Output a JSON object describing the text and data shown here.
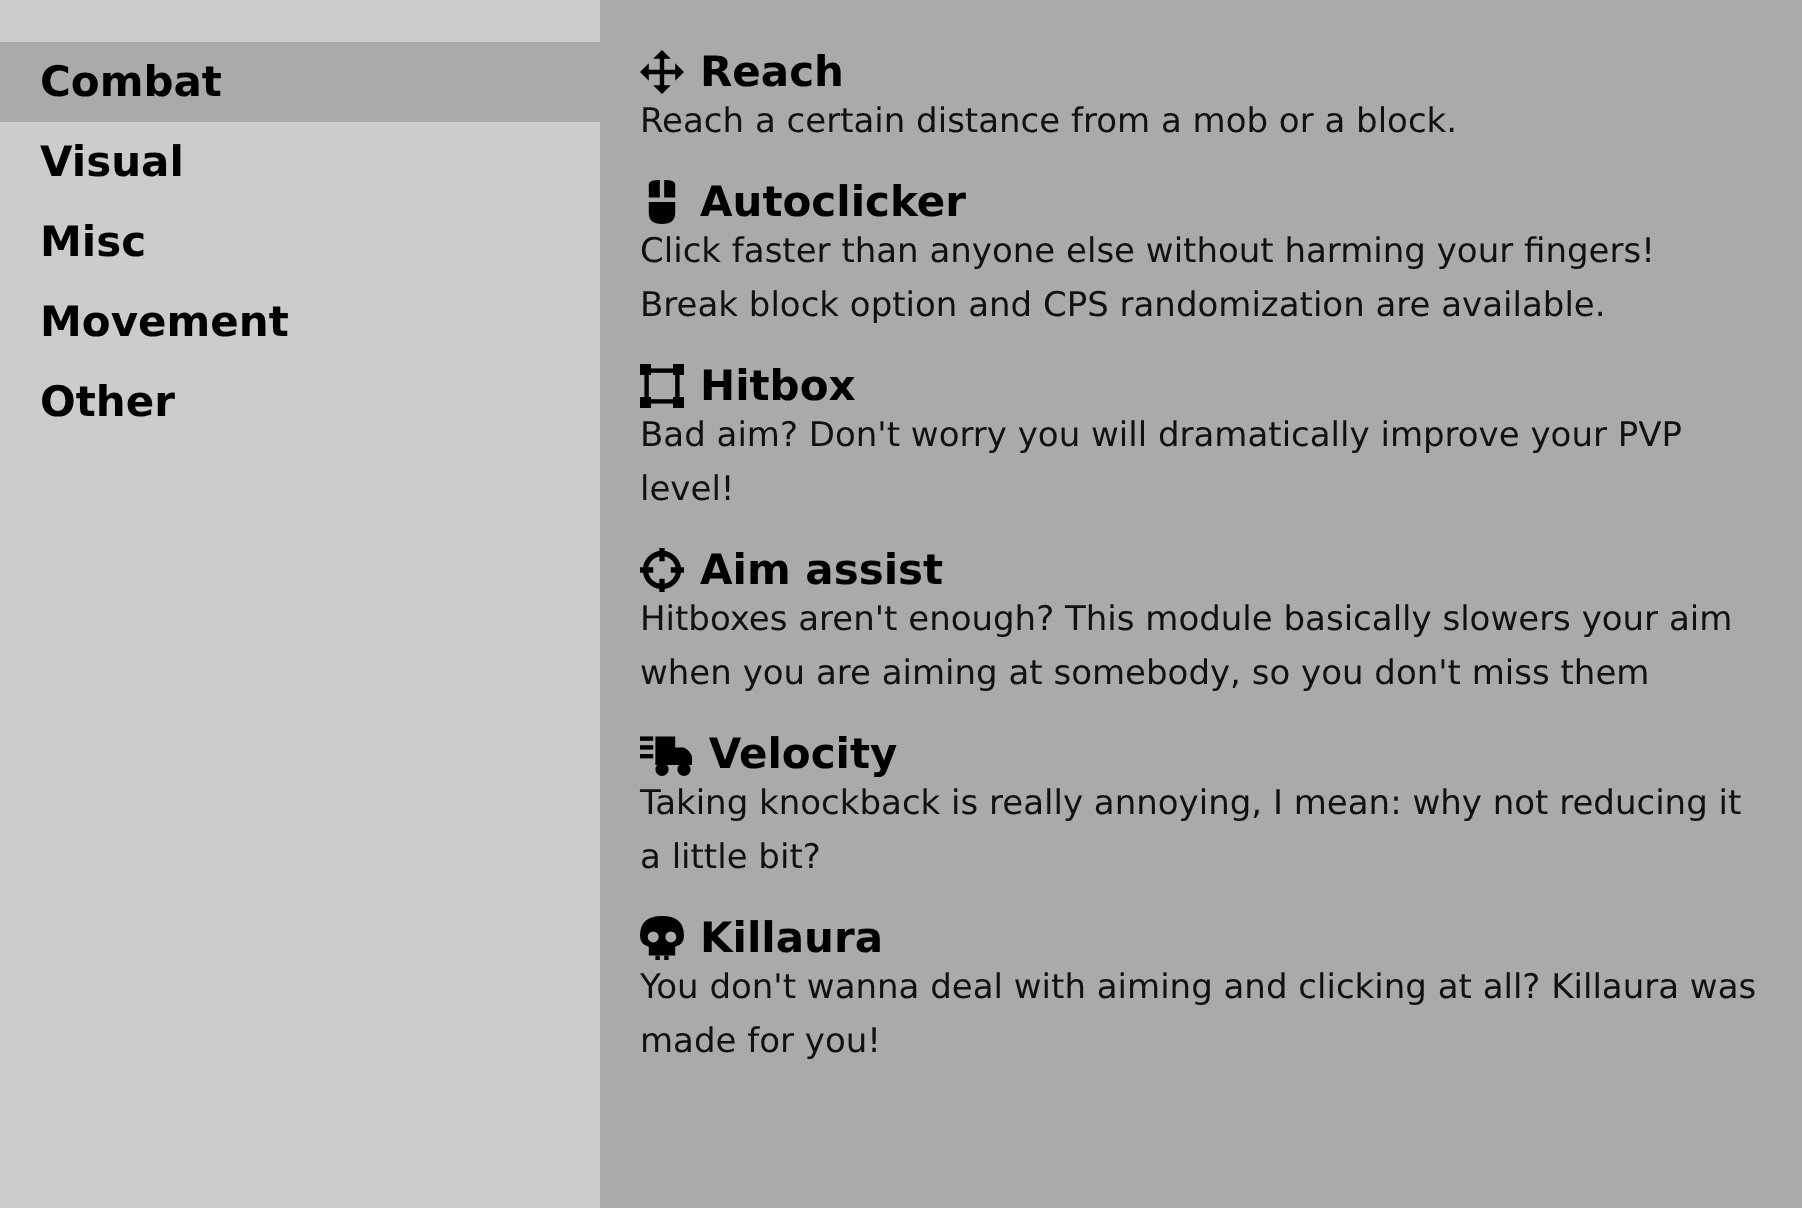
{
  "sidebar": {
    "items": [
      {
        "label": "Combat",
        "selected": true
      },
      {
        "label": "Visual",
        "selected": false
      },
      {
        "label": "Misc",
        "selected": false
      },
      {
        "label": "Movement",
        "selected": false
      },
      {
        "label": "Other",
        "selected": false
      }
    ]
  },
  "modules": [
    {
      "kind": "move",
      "title": "Reach",
      "description": "Reach a certain distance from a mob or a block."
    },
    {
      "kind": "mouse",
      "title": "Autoclicker",
      "description": "Click faster than anyone else without harming your fingers! Break block option and CPS randomization are available."
    },
    {
      "kind": "vector",
      "title": "Hitbox",
      "description": "Bad aim? Don't worry you will dramatically improve your PVP level!"
    },
    {
      "kind": "crosshairs",
      "title": "Aim assist",
      "description": "Hitboxes aren't enough? This module basically slowers your aim when you are aiming at somebody, so you don't miss them"
    },
    {
      "kind": "truck",
      "title": "Velocity",
      "description": "Taking knockback is really annoying, I mean: why not reducing it a little bit?"
    },
    {
      "kind": "skull",
      "title": "Killaura",
      "description": "You don't wanna deal with aiming and clicking at all? Killaura was made for you!"
    }
  ]
}
